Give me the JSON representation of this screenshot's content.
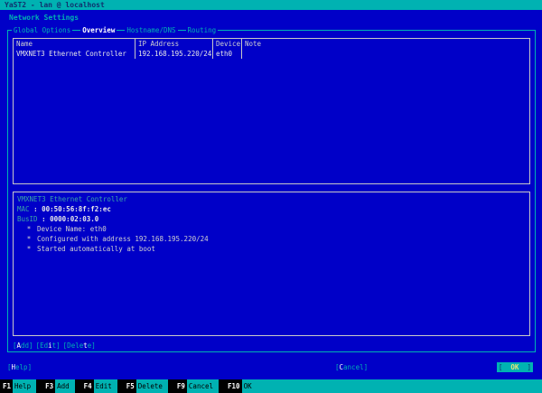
{
  "colors": {
    "bg": "#0000c8",
    "teal": "#00b2b2",
    "teal-dim": "#3aa6a6",
    "title-text": "#10306e",
    "box-border": "#c8c8c8",
    "text": "#d0d0d0",
    "bright": "#e8e8e8",
    "hot": "#ffffff",
    "ok-text": "#e6e67a"
  },
  "titlebar": {
    "title": "YaST2 - lan @ localhost"
  },
  "page": {
    "heading": "Network Settings"
  },
  "tabs": [
    {
      "label": "Global Options",
      "selected": false
    },
    {
      "label": "Overview",
      "selected": true
    },
    {
      "label": "Hostname/DNS",
      "selected": false
    },
    {
      "label": "Routing",
      "selected": false
    }
  ],
  "table": {
    "headers": [
      "Name",
      "IP Address",
      "Device",
      "Note"
    ],
    "rows": [
      [
        "VMXNET3 Ethernet Controller",
        "192.168.195.220/24",
        "eth0",
        ""
      ]
    ]
  },
  "details": {
    "title": "VMXNET3 Ethernet Controller",
    "mac": {
      "label": "MAC",
      "value": ": 00:50:56:8f:f2:ec"
    },
    "busid": {
      "label": "BusID",
      "value": ": 0000:02:03.0"
    },
    "bullet_marker": "*",
    "bullets": [
      "Device Name: eth0",
      "Configured with address 192.168.195.220/24",
      "Started automatically at boot"
    ]
  },
  "actions": {
    "add": {
      "pre": "[",
      "hot": "A",
      "post": "dd]"
    },
    "edit": {
      "pre": "[Ed",
      "hot": "i",
      "post": "t]"
    },
    "delete": {
      "pre": "[Dele",
      "hot": "t",
      "post": "e]"
    }
  },
  "footer": {
    "help": {
      "pre": "[",
      "hot": "H",
      "post": "elp]"
    },
    "cancel": {
      "pre": "[",
      "hot": "C",
      "post": "ancel]"
    },
    "ok": {
      "pre": "[  ",
      "label": "OK",
      "post": "  ]"
    }
  },
  "fnbar": {
    "items": [
      {
        "key": "F1",
        "label": "Help"
      },
      {
        "key": "F3",
        "label": "Add"
      },
      {
        "key": "F4",
        "label": "Edit"
      },
      {
        "key": "F5",
        "label": "Delete"
      },
      {
        "key": "F9",
        "label": "Cancel"
      },
      {
        "key": "F10",
        "label": "OK"
      }
    ]
  }
}
